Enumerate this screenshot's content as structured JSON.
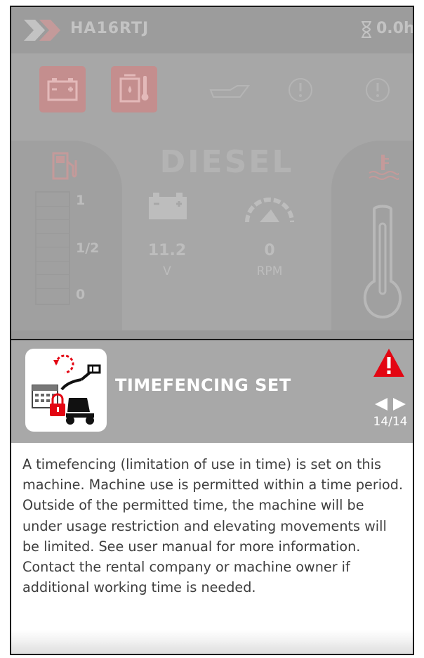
{
  "topbar": {
    "machine_id": "HA16RTJ",
    "hours": "0.0h",
    "logo_icon": "chevron-logo-icon",
    "hours_icon": "hourglass-icon"
  },
  "status_tiles": [
    {
      "icon": "battery-warning-icon",
      "active": true
    },
    {
      "icon": "hydraulic-oil-temp-icon",
      "active": true
    },
    {
      "icon": "oil-level-icon",
      "active": false
    },
    {
      "icon": "warning-circle-icon",
      "active": false
    },
    {
      "icon": "warning-circle-icon",
      "active": false
    }
  ],
  "engine": {
    "title": "DIESEL",
    "fuel_labels": [
      "1",
      "1/2",
      "0"
    ],
    "battery_voltage": "11.2",
    "battery_unit": "V",
    "rpm_value": "0",
    "rpm_unit": "RPM"
  },
  "alert": {
    "title": "TIMEFENCING SET",
    "icon": "timefencing-icon",
    "severity_icon": "warning-triangle-icon",
    "counter": "14/14",
    "message": "A timefencing (limitation of use in time) is set on this machine. Machine use is permitted within a time period. Outside of the permitted time, the machine will be under usage restriction and elevating movements will be limited. See user manual for more information. Contact the rental company or machine owner if additional working time is needed."
  },
  "colors": {
    "dim_overlay": "#a7a7a7",
    "alert_header": "#a8a8a8",
    "warning_red": "#e30613",
    "text_dark": "#3d3d3d"
  }
}
